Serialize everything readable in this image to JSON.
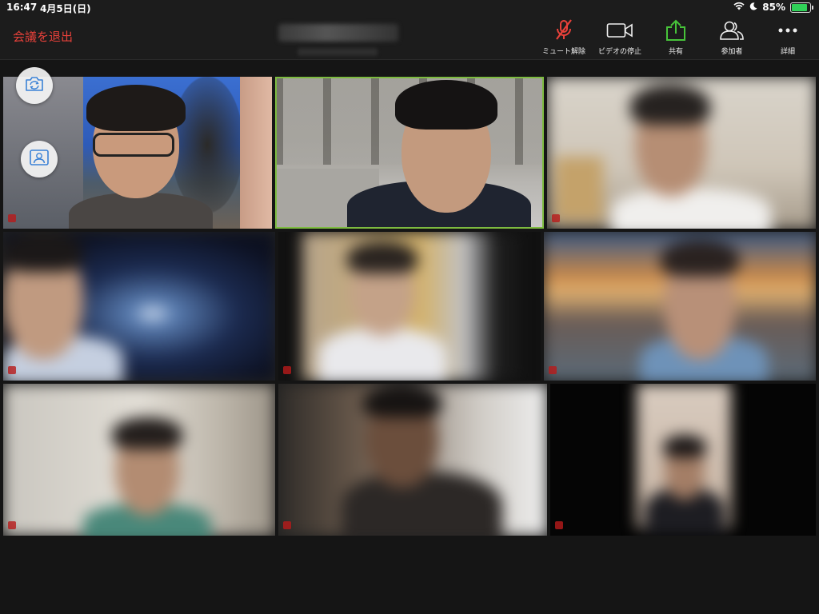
{
  "status_bar": {
    "time": "16:47",
    "date": "4月5日(日)",
    "battery": "85%"
  },
  "toolbar": {
    "leave_label": "会議を退出",
    "buttons": [
      {
        "label": "ミュート解除",
        "icon": "mic-muted-icon"
      },
      {
        "label": "ビデオの停止",
        "icon": "video-camera-icon"
      },
      {
        "label": "共有",
        "icon": "share-upload-icon"
      },
      {
        "label": "参加者",
        "icon": "participants-icon"
      },
      {
        "label": "詳細",
        "icon": "more-icon"
      }
    ]
  },
  "overlay": {
    "switch_camera_icon": "camera-switch-icon",
    "gallery_view_icon": "speaker-view-icon"
  },
  "colors": {
    "leave": "#e8413a",
    "mute_icon": "#e8413a",
    "share_icon": "#47c43a",
    "active_speaker_border": "#7dbb3f",
    "background": "#151515"
  },
  "participants": [
    {
      "name": "participant-1"
    },
    {
      "name": "participant-2",
      "active_speaker": true
    },
    {
      "name": "participant-3"
    },
    {
      "name": "participant-4"
    },
    {
      "name": "participant-5"
    },
    {
      "name": "participant-6"
    },
    {
      "name": "participant-7"
    },
    {
      "name": "participant-8"
    },
    {
      "name": "participant-9"
    }
  ]
}
